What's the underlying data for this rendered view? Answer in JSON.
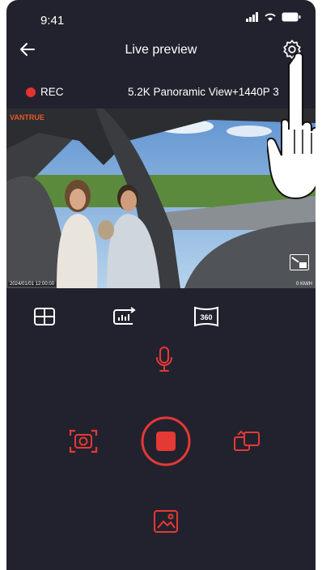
{
  "status": {
    "time": "9:41"
  },
  "header": {
    "title": "Live preview"
  },
  "recording": {
    "rec_label": "REC",
    "resolution": "5.2K Panoramic View+1440P 3"
  },
  "preview": {
    "watermark_logo": "VANTRUE",
    "hud_left": "2024/01/01 12:00:00",
    "hud_right": "0 KM/H"
  },
  "controls": {
    "row1": [
      "split-view",
      "stats",
      "360"
    ],
    "row1_360_label": "360",
    "main": [
      "snapshot",
      "record-stop",
      "switch-camera"
    ],
    "gallery": "gallery"
  },
  "colors": {
    "background": "#22222e",
    "accent": "#e53935",
    "rec_dot": "#e33232",
    "icon_white": "#ffffff"
  }
}
